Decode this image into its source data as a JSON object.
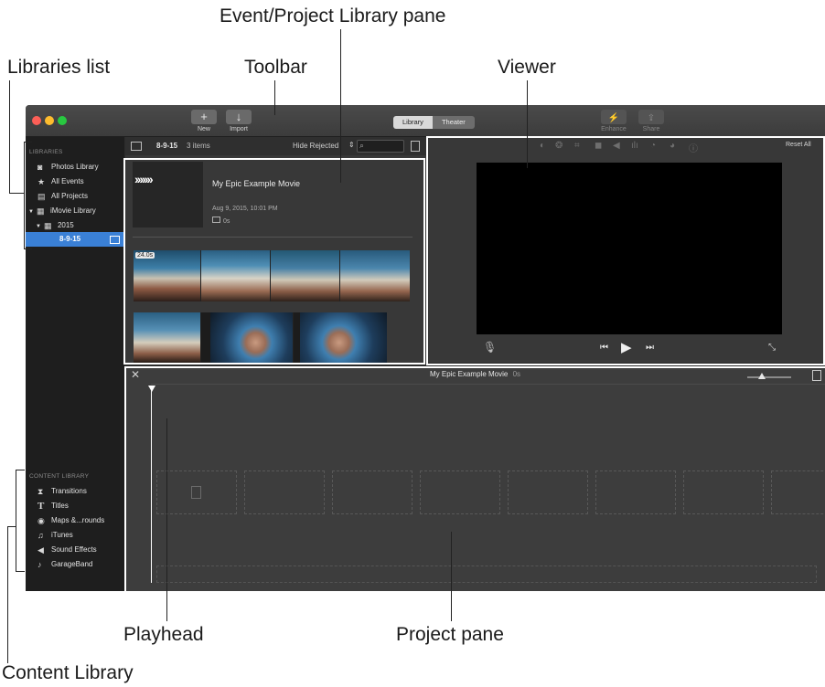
{
  "callouts": {
    "event_project_library_pane": "Event/Project Library pane",
    "libraries_list": "Libraries list",
    "toolbar": "Toolbar",
    "viewer": "Viewer",
    "playhead": "Playhead",
    "project_pane": "Project pane",
    "content_library": "Content Library"
  },
  "toolbar": {
    "new_icon": "+",
    "new_label": "New",
    "import_icon": "↓",
    "import_label": "Import",
    "library_label": "Library",
    "theater_label": "Theater",
    "enhance_label": "Enhance",
    "share_label": "Share"
  },
  "sidebar": {
    "libraries_heading": "LIBRARIES",
    "items": [
      {
        "label": "Photos Library",
        "icon": "camera-icon"
      },
      {
        "label": "All Events",
        "icon": "star-icon"
      },
      {
        "label": "All Projects",
        "icon": "clapper-icon"
      },
      {
        "label": "iMovie Library",
        "icon": "grid-icon"
      },
      {
        "label": "2015",
        "icon": "calendar-icon"
      },
      {
        "label": "8-9-15",
        "icon": "clip-icon"
      }
    ],
    "content_heading": "CONTENT LIBRARY",
    "content_items": [
      {
        "label": "Transitions",
        "icon": "transitions-icon"
      },
      {
        "label": "Titles",
        "icon": "titles-icon"
      },
      {
        "label": "Maps &...rounds",
        "icon": "globe-icon"
      },
      {
        "label": "iTunes",
        "icon": "music-note-icon"
      },
      {
        "label": "Sound Effects",
        "icon": "speaker-icon"
      },
      {
        "label": "GarageBand",
        "icon": "guitar-icon"
      }
    ]
  },
  "event_pane": {
    "event_name": "8-9-15",
    "item_count": "3 items",
    "filter_label": "Hide Rejected",
    "project_title": "My Epic Example Movie",
    "project_date": "Aug 9, 2015, 10:01 PM",
    "project_duration": "0s",
    "clip_duration": "24.0s"
  },
  "viewer": {
    "reset_label": "Reset All"
  },
  "project_pane": {
    "title": "My Epic Example Movie",
    "duration": "0s"
  }
}
